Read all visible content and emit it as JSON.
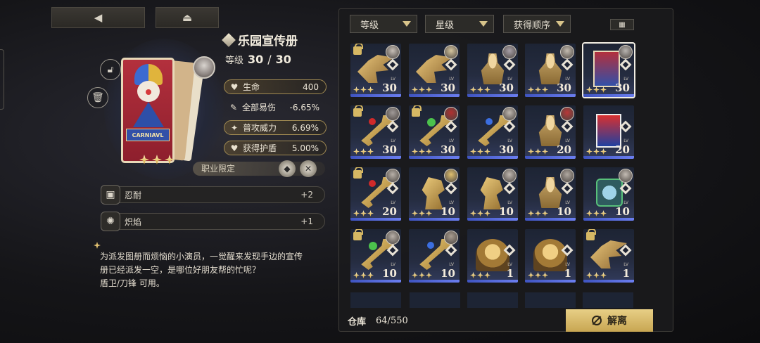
{
  "nav": {
    "back_glyph": "◀",
    "home_glyph": "⏏"
  },
  "item": {
    "name": "乐园宣传册",
    "level_label": "等级",
    "level_current": "30",
    "level_sep": "/",
    "level_max": "30",
    "card_text": "CARNIAVL",
    "stars": 3
  },
  "stats": [
    {
      "name": "生命",
      "value": "400",
      "icon": "heart-icon",
      "glyph": "♥",
      "boxed": true
    },
    {
      "name": "全部易伤",
      "value": "-6.65%",
      "icon": "quill-icon",
      "glyph": "✎",
      "boxed": false
    },
    {
      "name": "普攻威力",
      "value": "6.69%",
      "icon": "attack-icon",
      "glyph": "✦",
      "boxed": true
    },
    {
      "name": "获得护盾",
      "value": "5.00%",
      "icon": "shield-heart-icon",
      "glyph": "♥",
      "boxed": true
    }
  ],
  "class_limit": {
    "label": "职业限定"
  },
  "skills": [
    {
      "name": "忍耐",
      "value": "+2",
      "icon": "endurance-icon",
      "glyph": "▣"
    },
    {
      "name": "炽焰",
      "value": "+1",
      "icon": "flame-compass-icon",
      "glyph": "✺"
    }
  ],
  "description": {
    "line1": "为派发图册而烦恼的小演员，一觉醒来发现手边的宣传",
    "line2": "册已经派发一空，是哪位好朋友帮的忙呢？",
    "line3": "盾卫/刀锋 可用。"
  },
  "filters": [
    {
      "label": "等级"
    },
    {
      "label": "星级"
    },
    {
      "label": "获得顺序"
    }
  ],
  "inventory": {
    "lv_tag": "LV",
    "tiles": [
      {
        "level": "30",
        "art": "wing",
        "locked": true,
        "owner": "#c8c0b8",
        "selected": false
      },
      {
        "level": "30",
        "art": "wing",
        "locked": false,
        "owner": "#d6c6a0",
        "selected": false
      },
      {
        "level": "30",
        "art": "bust",
        "locked": false,
        "owner": "#a8a0a8",
        "selected": false
      },
      {
        "level": "30",
        "art": "bust",
        "locked": false,
        "owner": "#c4bcb0",
        "selected": false
      },
      {
        "level": "30",
        "art": "card",
        "locked": false,
        "owner": "#b8b4b0",
        "selected": true
      },
      {
        "level": "30",
        "art": "key-red",
        "locked": true,
        "owner": "#a09a98",
        "selected": false
      },
      {
        "level": "30",
        "art": "key-green",
        "locked": true,
        "owner": "#b03030",
        "selected": false
      },
      {
        "level": "30",
        "art": "key-blue",
        "locked": false,
        "owner": "#c0b8b0",
        "selected": false
      },
      {
        "level": "20",
        "art": "bust",
        "locked": false,
        "owner": "#b83838",
        "selected": false
      },
      {
        "level": "20",
        "art": "book",
        "locked": false,
        "owner": "",
        "selected": false
      },
      {
        "level": "20",
        "art": "key-red",
        "locked": true,
        "owner": "#b8b0a8",
        "selected": false
      },
      {
        "level": "10",
        "art": "horse",
        "locked": false,
        "owner": "#e0c070",
        "selected": false
      },
      {
        "level": "10",
        "art": "horse",
        "locked": false,
        "owner": "#c0b8b0",
        "selected": false
      },
      {
        "level": "10",
        "art": "bust",
        "locked": false,
        "owner": "#b0a8a0",
        "selected": false
      },
      {
        "level": "10",
        "art": "box",
        "locked": false,
        "owner": "#c4bcb4",
        "selected": false
      },
      {
        "level": "10",
        "art": "key-green",
        "locked": true,
        "owner": "#b8b0a8",
        "selected": false
      },
      {
        "level": "10",
        "art": "key-blue",
        "locked": false,
        "owner": "#a89c90",
        "selected": false
      },
      {
        "level": "1",
        "art": "lion",
        "locked": false,
        "owner": "",
        "selected": false
      },
      {
        "level": "1",
        "art": "lion",
        "locked": false,
        "owner": "",
        "selected": false
      },
      {
        "level": "1",
        "art": "wing",
        "locked": true,
        "owner": "",
        "selected": false
      }
    ]
  },
  "footer": {
    "storage_label": "仓库",
    "storage_value": "64/550",
    "dismantle_label": "解离"
  },
  "colors": {
    "accent_gold": "#d4b060",
    "tile_blue": "#3f54c0"
  }
}
